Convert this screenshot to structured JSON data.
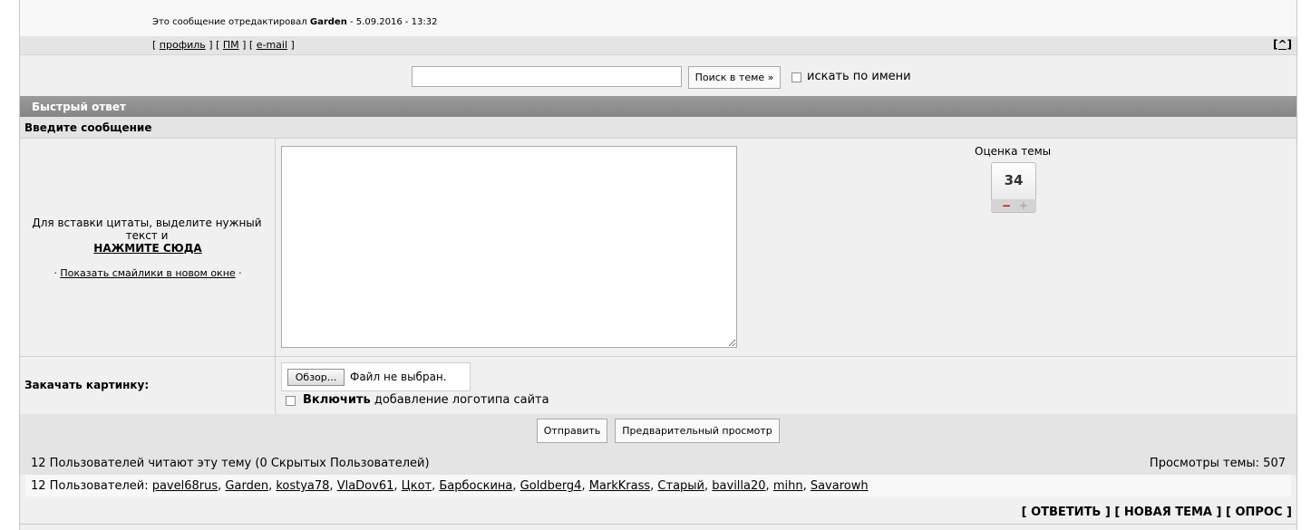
{
  "post": {
    "edited_prefix": "Это сообщение отредактировал",
    "edited_by": "Garden",
    "edited_date": "- 5.09.2016 - 13:32",
    "links": {
      "profile": "профиль",
      "pm": "ПМ",
      "email": "e-mail"
    },
    "to_top": "[^]"
  },
  "search": {
    "input_value": "",
    "button_label": "Поиск в теме »",
    "by_name_label": "искать по имени"
  },
  "quick_reply": {
    "header": "Быстрый ответ",
    "enter_message": "Введите сообщение",
    "quote_hint": "Для вставки цитаты, выделите нужный текст и",
    "quote_link": "НАЖМИТЕ СЮДА",
    "smiles_link": "Показать смайлики в новом окне",
    "message_value": "",
    "rating": {
      "label": "Оценка темы",
      "value": "34",
      "minus": "−",
      "plus": "+"
    },
    "upload": {
      "label": "Закачать картинку:",
      "browse_label": "Обзор...",
      "file_status": "Файл не выбран.",
      "logo_bold": "Включить",
      "logo_rest": "добавление логотипа сайта"
    },
    "send_label": "Отправить",
    "preview_label": "Предварительный просмотр"
  },
  "readers": {
    "summary": "12 Пользователей читают эту тему (0 Скрытых Пользователей)",
    "views": "Просмотры темы: 507",
    "users_prefix": "12 Пользователей:",
    "users": [
      "pavel68rus",
      "Garden",
      "kostya78",
      "VlaDov61",
      "Цкот",
      "Барбоскина",
      "Goldberg4",
      "MarkKrass",
      "Старый",
      "bavilla20",
      "mihn",
      "Savarowh"
    ]
  },
  "actions": {
    "reply": "ОТВЕТИТЬ",
    "new_topic": "НОВАЯ ТЕМА",
    "poll": "ОПРОС"
  }
}
